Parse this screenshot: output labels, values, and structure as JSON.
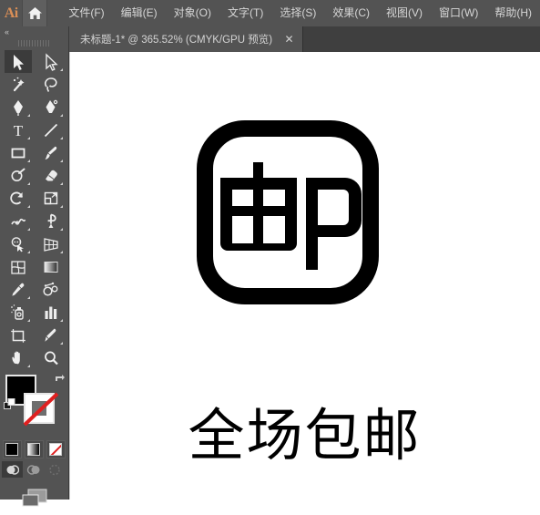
{
  "app": {
    "logo": "Ai",
    "home_icon": "home-icon"
  },
  "menubar": {
    "items": [
      {
        "label": "文件(F)",
        "name": "menu-file"
      },
      {
        "label": "编辑(E)",
        "name": "menu-edit"
      },
      {
        "label": "对象(O)",
        "name": "menu-object"
      },
      {
        "label": "文字(T)",
        "name": "menu-type"
      },
      {
        "label": "选择(S)",
        "name": "menu-select"
      },
      {
        "label": "效果(C)",
        "name": "menu-effect"
      },
      {
        "label": "视图(V)",
        "name": "menu-view"
      },
      {
        "label": "窗口(W)",
        "name": "menu-window"
      },
      {
        "label": "帮助(H)",
        "name": "menu-help"
      }
    ]
  },
  "tabbar": {
    "tabs": [
      {
        "title": "未标题-1* @ 365.52% (CMYK/GPU 预览)",
        "close_label": "✕",
        "active": true
      }
    ]
  },
  "toolbar": {
    "collapse_label": "«",
    "tools": [
      {
        "name": "selection-tool",
        "label": "选择工具",
        "selected": true,
        "hasflyout": false
      },
      {
        "name": "direct-selection-tool",
        "label": "直接选择工具",
        "selected": false,
        "hasflyout": true
      },
      {
        "name": "magic-wand-tool",
        "label": "魔棒工具",
        "selected": false,
        "hasflyout": false
      },
      {
        "name": "lasso-tool",
        "label": "套索工具",
        "selected": false,
        "hasflyout": false
      },
      {
        "name": "pen-tool",
        "label": "钢笔工具",
        "selected": false,
        "hasflyout": true
      },
      {
        "name": "curvature-tool",
        "label": "曲率工具",
        "selected": false,
        "hasflyout": true
      },
      {
        "name": "type-tool",
        "label": "文字工具",
        "selected": false,
        "hasflyout": true
      },
      {
        "name": "line-segment-tool",
        "label": "直线段工具",
        "selected": false,
        "hasflyout": true
      },
      {
        "name": "rectangle-tool",
        "label": "矩形工具",
        "selected": false,
        "hasflyout": true
      },
      {
        "name": "paintbrush-tool",
        "label": "画笔工具",
        "selected": false,
        "hasflyout": true
      },
      {
        "name": "shaper-tool",
        "label": "Shaper 工具",
        "selected": false,
        "hasflyout": true
      },
      {
        "name": "eraser-tool",
        "label": "橡皮擦工具",
        "selected": false,
        "hasflyout": true
      },
      {
        "name": "rotate-tool",
        "label": "旋转工具",
        "selected": false,
        "hasflyout": true
      },
      {
        "name": "scale-tool",
        "label": "比例缩放工具",
        "selected": false,
        "hasflyout": true
      },
      {
        "name": "width-tool",
        "label": "宽度工具",
        "selected": false,
        "hasflyout": true
      },
      {
        "name": "free-transform-tool",
        "label": "自由变换工具",
        "selected": false,
        "hasflyout": true
      },
      {
        "name": "shape-builder-tool",
        "label": "形状生成器工具",
        "selected": false,
        "hasflyout": true
      },
      {
        "name": "perspective-grid-tool",
        "label": "透视网格工具",
        "selected": false,
        "hasflyout": true
      },
      {
        "name": "mesh-tool",
        "label": "网格工具",
        "selected": false,
        "hasflyout": false
      },
      {
        "name": "gradient-tool",
        "label": "渐变工具",
        "selected": false,
        "hasflyout": false
      },
      {
        "name": "eyedropper-tool",
        "label": "吸管工具",
        "selected": false,
        "hasflyout": true
      },
      {
        "name": "blend-tool",
        "label": "混合工具",
        "selected": false,
        "hasflyout": false
      },
      {
        "name": "symbol-sprayer-tool",
        "label": "符号喷枪工具",
        "selected": false,
        "hasflyout": true
      },
      {
        "name": "column-graph-tool",
        "label": "柱形图工具",
        "selected": false,
        "hasflyout": true
      },
      {
        "name": "artboard-tool",
        "label": "画板工具",
        "selected": false,
        "hasflyout": false
      },
      {
        "name": "slice-tool",
        "label": "切片工具",
        "selected": false,
        "hasflyout": true
      },
      {
        "name": "hand-tool",
        "label": "抓手工具",
        "selected": false,
        "hasflyout": true
      },
      {
        "name": "zoom-tool",
        "label": "缩放工具",
        "selected": false,
        "hasflyout": false
      }
    ],
    "fill_color": "#000000",
    "stroke_color": "none",
    "swap_icon": "swap-fill-stroke-icon",
    "default_icon": "default-fill-stroke-icon",
    "mode_buttons": [
      {
        "name": "color-button",
        "label": "颜色"
      },
      {
        "name": "gradient-button",
        "label": "渐变"
      },
      {
        "name": "none-button",
        "label": "无"
      }
    ],
    "draw_modes": [
      {
        "name": "draw-normal-button",
        "label": "正常绘图",
        "active": true
      },
      {
        "name": "draw-behind-button",
        "label": "背面绘图",
        "active": false
      },
      {
        "name": "draw-inside-button",
        "label": "内部绘图",
        "active": false
      }
    ],
    "screen_mode": {
      "name": "change-screen-mode-button",
      "label": "更改屏幕模式"
    }
  },
  "canvas": {
    "artwork_title": "邮政图标",
    "glyph": "邮",
    "caption": "全场包邮",
    "art_color": "#000000",
    "background": "#ffffff"
  }
}
